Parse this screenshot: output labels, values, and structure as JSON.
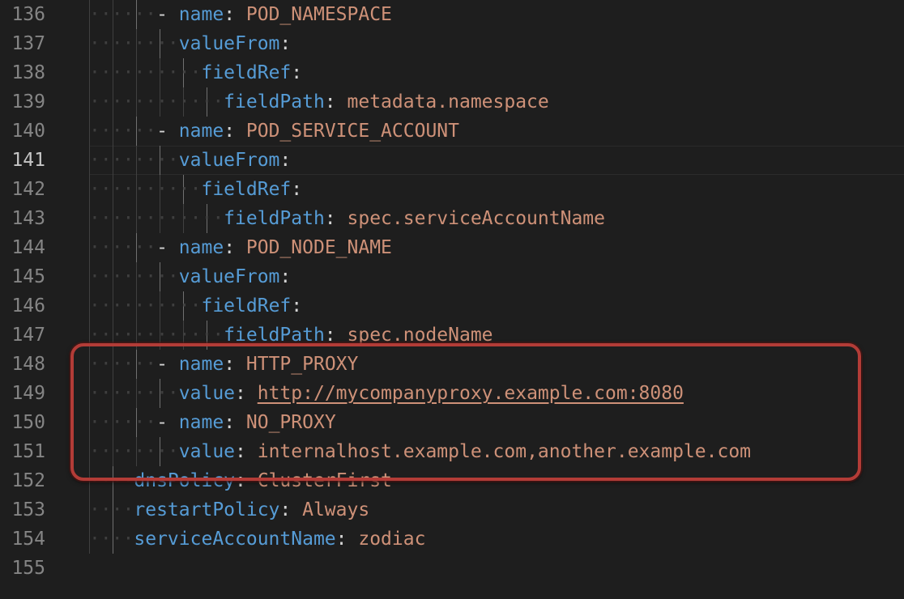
{
  "editor": {
    "current_line": "141",
    "lines": [
      {
        "num": "136",
        "parts": [
          {
            "t": "ws",
            "s": "······"
          },
          {
            "t": "dash",
            "s": "- "
          },
          {
            "t": "key",
            "s": "name"
          },
          {
            "t": "colon",
            "s": ": "
          },
          {
            "t": "val",
            "s": "POD_NAMESPACE"
          }
        ]
      },
      {
        "num": "137",
        "parts": [
          {
            "t": "ws",
            "s": "········"
          },
          {
            "t": "key",
            "s": "valueFrom"
          },
          {
            "t": "colon",
            "s": ":"
          }
        ]
      },
      {
        "num": "138",
        "parts": [
          {
            "t": "ws",
            "s": "··········"
          },
          {
            "t": "key",
            "s": "fieldRef"
          },
          {
            "t": "colon",
            "s": ":"
          }
        ]
      },
      {
        "num": "139",
        "parts": [
          {
            "t": "ws",
            "s": "············"
          },
          {
            "t": "key",
            "s": "fieldPath"
          },
          {
            "t": "colon",
            "s": ": "
          },
          {
            "t": "val",
            "s": "metadata.namespace"
          }
        ]
      },
      {
        "num": "140",
        "parts": [
          {
            "t": "ws",
            "s": "······"
          },
          {
            "t": "dash",
            "s": "- "
          },
          {
            "t": "key",
            "s": "name"
          },
          {
            "t": "colon",
            "s": ": "
          },
          {
            "t": "val",
            "s": "POD_SERVICE_ACCOUNT"
          }
        ]
      },
      {
        "num": "141",
        "parts": [
          {
            "t": "ws",
            "s": "········"
          },
          {
            "t": "key",
            "s": "valueFrom"
          },
          {
            "t": "colon",
            "s": ":"
          }
        ]
      },
      {
        "num": "142",
        "parts": [
          {
            "t": "ws",
            "s": "··········"
          },
          {
            "t": "key",
            "s": "fieldRef"
          },
          {
            "t": "colon",
            "s": ":"
          }
        ]
      },
      {
        "num": "143",
        "parts": [
          {
            "t": "ws",
            "s": "············"
          },
          {
            "t": "key",
            "s": "fieldPath"
          },
          {
            "t": "colon",
            "s": ": "
          },
          {
            "t": "val",
            "s": "spec.serviceAccountName"
          }
        ]
      },
      {
        "num": "144",
        "parts": [
          {
            "t": "ws",
            "s": "······"
          },
          {
            "t": "dash",
            "s": "- "
          },
          {
            "t": "key",
            "s": "name"
          },
          {
            "t": "colon",
            "s": ": "
          },
          {
            "t": "val",
            "s": "POD_NODE_NAME"
          }
        ]
      },
      {
        "num": "145",
        "parts": [
          {
            "t": "ws",
            "s": "········"
          },
          {
            "t": "key",
            "s": "valueFrom"
          },
          {
            "t": "colon",
            "s": ":"
          }
        ]
      },
      {
        "num": "146",
        "parts": [
          {
            "t": "ws",
            "s": "··········"
          },
          {
            "t": "key",
            "s": "fieldRef"
          },
          {
            "t": "colon",
            "s": ":"
          }
        ]
      },
      {
        "num": "147",
        "parts": [
          {
            "t": "ws",
            "s": "············"
          },
          {
            "t": "key",
            "s": "fieldPath"
          },
          {
            "t": "colon",
            "s": ": "
          },
          {
            "t": "val",
            "s": "spec.nodeName"
          }
        ]
      },
      {
        "num": "148",
        "parts": [
          {
            "t": "ws",
            "s": "······"
          },
          {
            "t": "dash",
            "s": "- "
          },
          {
            "t": "key",
            "s": "name"
          },
          {
            "t": "colon",
            "s": ": "
          },
          {
            "t": "val",
            "s": "HTTP_PROXY"
          }
        ]
      },
      {
        "num": "149",
        "parts": [
          {
            "t": "ws",
            "s": "········"
          },
          {
            "t": "key",
            "s": "value"
          },
          {
            "t": "colon",
            "s": ": "
          },
          {
            "t": "val url",
            "s": "http://mycompanyproxy.example.com:8080"
          }
        ]
      },
      {
        "num": "150",
        "parts": [
          {
            "t": "ws",
            "s": "······"
          },
          {
            "t": "dash",
            "s": "- "
          },
          {
            "t": "key",
            "s": "name"
          },
          {
            "t": "colon",
            "s": ": "
          },
          {
            "t": "val",
            "s": "NO_PROXY"
          }
        ]
      },
      {
        "num": "151",
        "parts": [
          {
            "t": "ws",
            "s": "········"
          },
          {
            "t": "key",
            "s": "value"
          },
          {
            "t": "colon",
            "s": ": "
          },
          {
            "t": "val",
            "s": "internalhost.example.com,another.example.com"
          }
        ]
      },
      {
        "num": "152",
        "parts": [
          {
            "t": "ws",
            "s": "····"
          },
          {
            "t": "key",
            "s": "dnsPolicy"
          },
          {
            "t": "colon",
            "s": ": "
          },
          {
            "t": "val",
            "s": "ClusterFirst"
          }
        ]
      },
      {
        "num": "153",
        "parts": [
          {
            "t": "ws",
            "s": "····"
          },
          {
            "t": "key",
            "s": "restartPolicy"
          },
          {
            "t": "colon",
            "s": ": "
          },
          {
            "t": "val",
            "s": "Always"
          }
        ]
      },
      {
        "num": "154",
        "parts": [
          {
            "t": "ws",
            "s": "····"
          },
          {
            "t": "key",
            "s": "serviceAccountName"
          },
          {
            "t": "colon",
            "s": ": "
          },
          {
            "t": "val",
            "s": "zodiac"
          }
        ]
      },
      {
        "num": "155",
        "parts": []
      }
    ]
  },
  "colors": {
    "background": "#1e1e1e",
    "line_number": "#858585",
    "key": "#569cd6",
    "string": "#ce9178",
    "highlight_box": "#b33c37"
  }
}
